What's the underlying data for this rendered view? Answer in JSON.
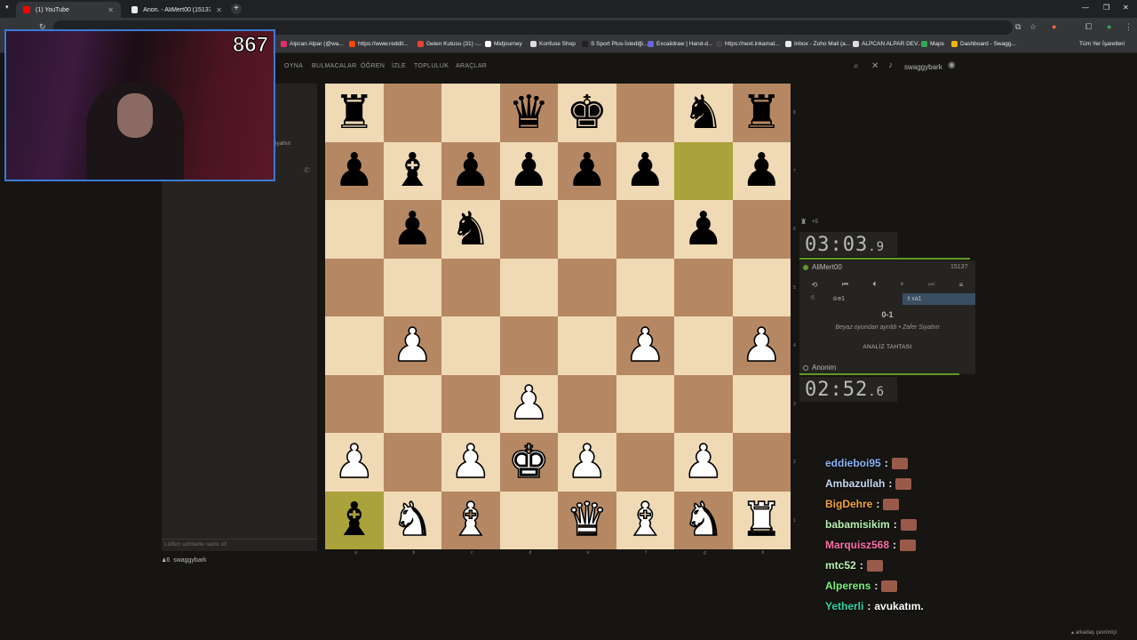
{
  "browser": {
    "tabs": [
      {
        "title": "(1) YouTube",
        "fav_color": "#ff0000"
      },
      {
        "title": "Anon. - AliMert00 (15137) • sp...",
        "fav_color": "#e8eaed"
      }
    ],
    "bookmarks": [
      {
        "label": "Alpcan Alpar (@wa...",
        "color": "#e1306c"
      },
      {
        "label": "https://www.reddit...",
        "color": "#ff4500"
      },
      {
        "label": "Gelen Kutusu (31) -...",
        "color": "#ea4335"
      },
      {
        "label": "Midjourney",
        "color": "#ffffff"
      },
      {
        "label": "Konfuse Shop",
        "color": "#dddddd"
      },
      {
        "label": "S Sport Plus-İstediği...",
        "color": "#222222"
      },
      {
        "label": "Excalidraw | Hand-d...",
        "color": "#6965db"
      },
      {
        "label": "https://next.inkamat...",
        "color": "#444444"
      },
      {
        "label": "Inbox - Zoho Mail (a...",
        "color": "#e8eaed"
      },
      {
        "label": "ALPCAN ALPAR DEV...",
        "color": "#dddddd"
      },
      {
        "label": "Maps",
        "color": "#34a853"
      },
      {
        "label": "Dashboard - Swagg...",
        "color": "#f4b400"
      }
    ],
    "all_bookmarks": "Tüm Yer İşaretleri"
  },
  "nav": {
    "items": [
      "OYNA",
      "BULMACALAR",
      "ÖĞREN",
      "İZLE",
      "TOPLULUK",
      "ARAÇLAR"
    ],
    "username": "swaggybark"
  },
  "left": {
    "chat_placeholder": "Lütfen sohbette nazik ol!",
    "spectator_count": "6",
    "spectator_name": "swaggybark",
    "partial_text": "iyahın"
  },
  "webcam": {
    "viewers": "867"
  },
  "board": {
    "ranks": [
      [
        "bR",
        "",
        "",
        "bQ",
        "bK",
        "",
        "bN",
        "bR"
      ],
      [
        "bP",
        "bB",
        "bP",
        "bP",
        "bP",
        "bP",
        "",
        "bP"
      ],
      [
        "",
        "bP",
        "bN",
        "",
        "",
        "",
        "bP",
        ""
      ],
      [
        "",
        "",
        "",
        "",
        "",
        "",
        "",
        ""
      ],
      [
        "",
        "wP",
        "",
        "",
        "",
        "wP",
        "",
        "wP"
      ],
      [
        "",
        "",
        "",
        "wP",
        "",
        "",
        "",
        ""
      ],
      [
        "wP",
        "",
        "wP",
        "wK",
        "wP",
        "",
        "wP",
        ""
      ],
      [
        "bB",
        "wN",
        "wB",
        "",
        "wQ",
        "wB",
        "wN",
        "wR"
      ]
    ],
    "highlights": [
      "g7",
      "a1"
    ],
    "files": [
      "a",
      "b",
      "c",
      "d",
      "e",
      "f",
      "g",
      "h"
    ],
    "rank_labels": [
      "8",
      "7",
      "6",
      "5",
      "4",
      "3",
      "2",
      "1"
    ]
  },
  "game": {
    "captured_note": "+5",
    "top_clock": {
      "main": "03:03",
      "tenths": "9"
    },
    "top_player": "AliMert00",
    "top_rating": "1513?",
    "move_number": "6",
    "white_move": "♔e1",
    "black_move": "♗xa1",
    "result": "0-1",
    "status": "Beyaz oyundan ayrıldı • Zafer Siyahın",
    "analysis_button": "ANALİZ TAHTASI",
    "bottom_player": "Anonim",
    "bottom_clock": {
      "main": "02:52",
      "tenths": "6"
    }
  },
  "stream_chat": [
    {
      "user": "eddieboi95",
      "color": "#8ab4f8",
      "text": ""
    },
    {
      "user": "Ambazullah",
      "color": "#c6d9f1",
      "text": ""
    },
    {
      "user": "BigDehre",
      "color": "#f4a233",
      "text": ""
    },
    {
      "user": "babamisikim",
      "color": "#b8f3b0",
      "text": ""
    },
    {
      "user": "Marquisz568",
      "color": "#ff6fa8",
      "text": ""
    },
    {
      "user": "mtc52",
      "color": "#b8f3b0",
      "text": ""
    },
    {
      "user": "Alperens",
      "color": "#7cf07c",
      "text": ""
    },
    {
      "user": "Yetherli",
      "color": "#37d4a6",
      "text": "avukatım."
    }
  ],
  "footer": {
    "friends": "arkadaş çevrimiçi"
  }
}
